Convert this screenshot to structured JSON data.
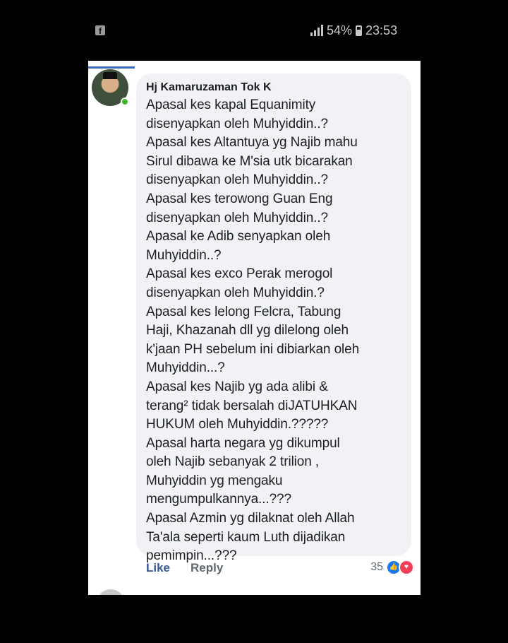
{
  "status_bar": {
    "app_icon": "facebook-icon",
    "signal_icon": "signal-bars-icon",
    "battery_text": "54%",
    "battery_icon": "battery-icon",
    "time": "23:53"
  },
  "comment": {
    "author": "Hj Kamaruzaman Tok K",
    "avatar_icon": "avatar",
    "online": true,
    "text": "Apasal kes kapal Equanimity\ndisenyapkan oleh Muhyiddin..?\nApasal kes Altantuya yg Najib mahu\nSirul dibawa ke M'sia utk bicarakan\ndisenyapkan oleh Muhyiddin..?\nApasal kes terowong Guan Eng\ndisenyapkan oleh Muhyiddin..?\nApasal ke Adib senyapkan oleh\nMuhyiddin..?\nApasal kes exco Perak merogol\ndisenyapkan oleh Muhyiddin.?\nApasal kes lelong Felcra, Tabung\nHaji, Khazanah dll yg dilelong oleh\nk'jaan PH sebelum ini dibiarkan oleh\nMuhyiddin...?\nApasal kes Najib yg ada alibi &\nterang² tidak bersalah diJATUHKAN\nHUKUM oleh Muhyiddin.?????\nApasal harta negara yg dikumpul\noleh Najib sebanyak 2 trilion ,\nMuhyiddin yg mengaku\nmengumpulkannya...???\nApasal Azmin yg dilaknat oleh Allah\nTa'ala seperti kaum Luth dijadikan\npemimpin...???",
    "actions": {
      "like_label": "Like",
      "reply_label": "Reply",
      "reaction_count": "35",
      "reaction_icons": [
        "like-reaction-icon",
        "love-reaction-icon"
      ]
    }
  },
  "colors": {
    "link_blue": "#385898",
    "bubble_bg": "#f0f2f5",
    "online_green": "#42b72a"
  }
}
